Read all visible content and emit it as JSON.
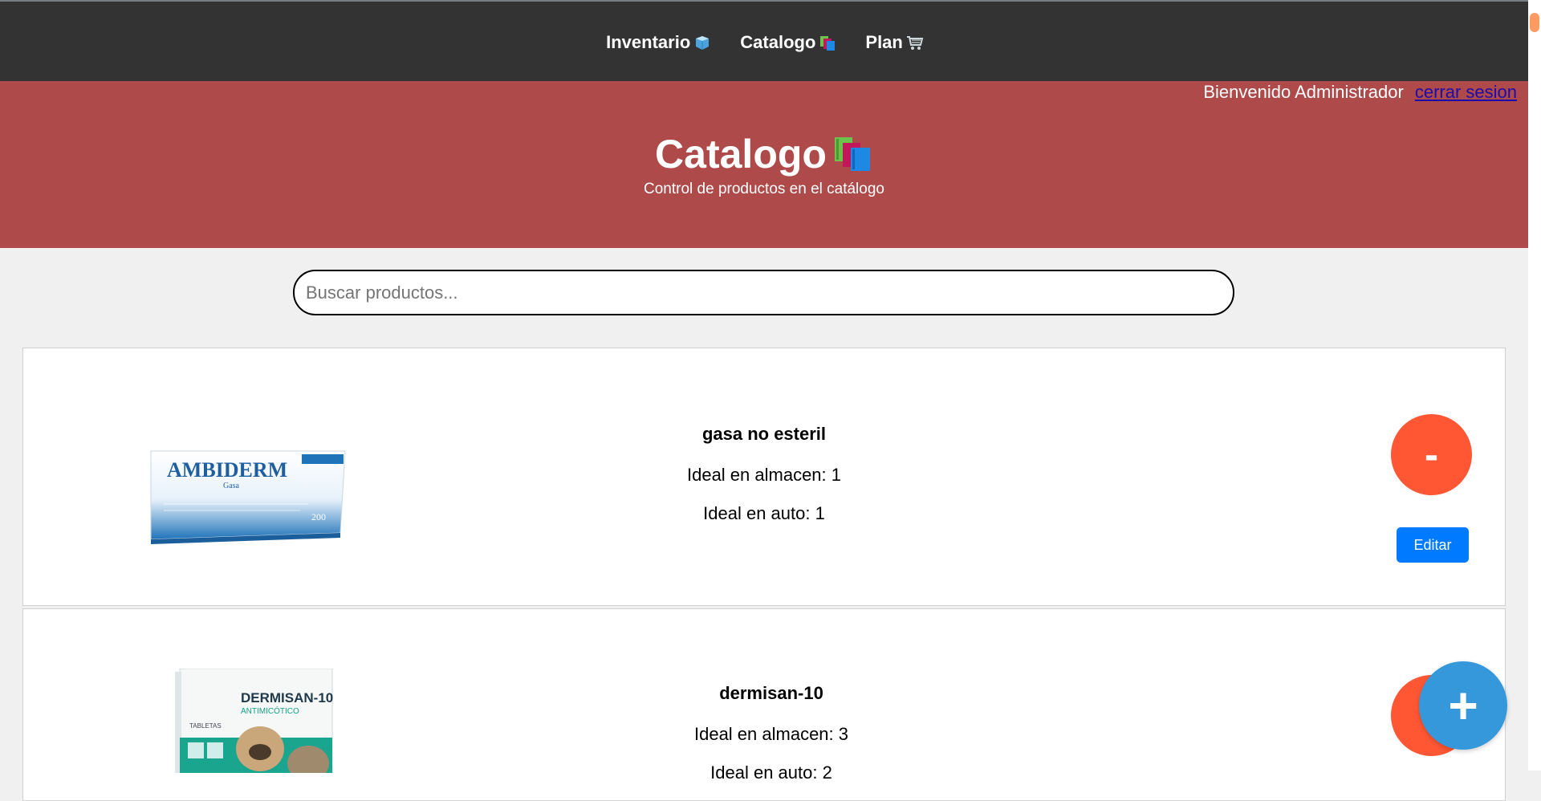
{
  "nav": {
    "items": [
      {
        "label": "Inventario",
        "icon": "package-icon"
      },
      {
        "label": "Catalogo",
        "icon": "books-icon"
      },
      {
        "label": "Plan",
        "icon": "cart-icon"
      }
    ]
  },
  "header": {
    "welcome": "Bienvenido Administrador",
    "logout": "cerrar sesion",
    "title": "Catalogo",
    "subtitle": "Control de productos en el catálogo",
    "colors": {
      "banner": "#af4a4a",
      "nav": "#333333"
    }
  },
  "search": {
    "placeholder": "Buscar productos...",
    "value": ""
  },
  "products": [
    {
      "name": "gasa no esteril",
      "ideal_almacen": "Ideal en almacen: 1",
      "ideal_auto": "Ideal en auto: 1",
      "image": {
        "brand": "AMBIDERM",
        "sub": "Gasa",
        "count": "200"
      },
      "remove_label": "-",
      "edit_label": "Editar"
    },
    {
      "name": "dermisan-10",
      "ideal_almacen": "Ideal en almacen: 3",
      "ideal_auto": "Ideal en auto: 2",
      "image": {
        "brand": "DERMISAN-10",
        "sub": "ANTIMICÓTICO",
        "type": "TABLETAS"
      },
      "remove_label": "-"
    }
  ],
  "fab": {
    "label": "+"
  },
  "accent": {
    "remove": "#ff5733",
    "edit": "#007bff",
    "fab": "#3498db"
  }
}
